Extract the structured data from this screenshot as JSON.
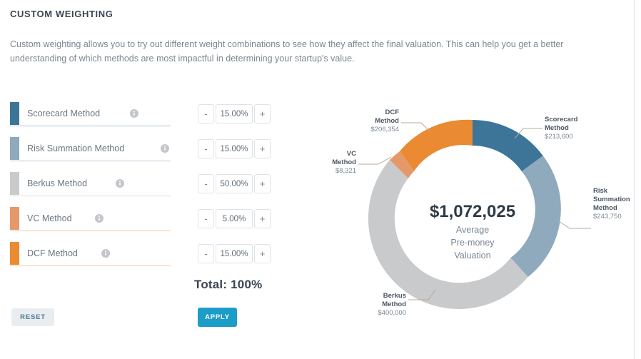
{
  "header": {
    "title": "CUSTOM WEIGHTING",
    "description": "Custom weighting allows you to try out different weight combinations to see how they affect the final valuation. This can help you get a better understanding of which methods are most impactful in determining your startup's value."
  },
  "weights": {
    "rows": [
      {
        "label": "Scorecard Method",
        "value": "15.00%",
        "color": "#3d7599",
        "info_icon": "info-icon"
      },
      {
        "label": "Risk Summation Method",
        "value": "15.00%",
        "color": "#8fa9bd",
        "info_icon": "info-icon"
      },
      {
        "label": "Berkus Method",
        "value": "50.00%",
        "color": "#c9cacb",
        "info_icon": "info-icon"
      },
      {
        "label": "VC Method",
        "value": "5.00%",
        "color": "#e5996b",
        "info_icon": "info-icon"
      },
      {
        "label": "DCF Method",
        "value": "15.00%",
        "color": "#ea8a32",
        "info_icon": "info-icon"
      }
    ],
    "decrement_label": "-",
    "increment_label": "+",
    "total_label": "Total: 100%"
  },
  "actions": {
    "reset_label": "RESET",
    "apply_label": "APPLY",
    "apply_color": "#1b9dc8",
    "reset_color": "#eaedf0"
  },
  "chart_data": {
    "type": "pie",
    "title": "",
    "center_value": "$1,072,025",
    "center_sub_line1": "Average",
    "center_sub_line2": "Pre-money",
    "center_sub_line3": "Valuation",
    "legend_position": "callout-labels",
    "categories": [
      "Scorecard Method",
      "Risk Summation Method",
      "Berkus Method",
      "VC Method",
      "DCF Method"
    ],
    "values": [
      213600,
      243750,
      400000,
      8321,
      206354
    ],
    "value_labels": [
      "$213,600",
      "$243,750",
      "$400,000",
      "$8,321",
      "$206,354"
    ],
    "colors": [
      "#3d7599",
      "#8fa9bd",
      "#c9cacb",
      "#e5996b",
      "#ea8a32"
    ],
    "weights_percent": [
      15,
      15,
      50,
      5,
      15
    ],
    "labels": [
      {
        "name_line1": "Scorecard",
        "name_line2": "Method",
        "value": "$213,600"
      },
      {
        "name_line1": "Risk",
        "name_line2": "Summation",
        "name_line3": "Method",
        "value": "$243,750"
      },
      {
        "name_line1": "Berkus",
        "name_line2": "Method",
        "value": "$400,000"
      },
      {
        "name_line1": "VC",
        "name_line2": "Method",
        "value": "$8,321"
      },
      {
        "name_line1": "DCF",
        "name_line2": "Method",
        "value": "$206,354"
      }
    ]
  }
}
